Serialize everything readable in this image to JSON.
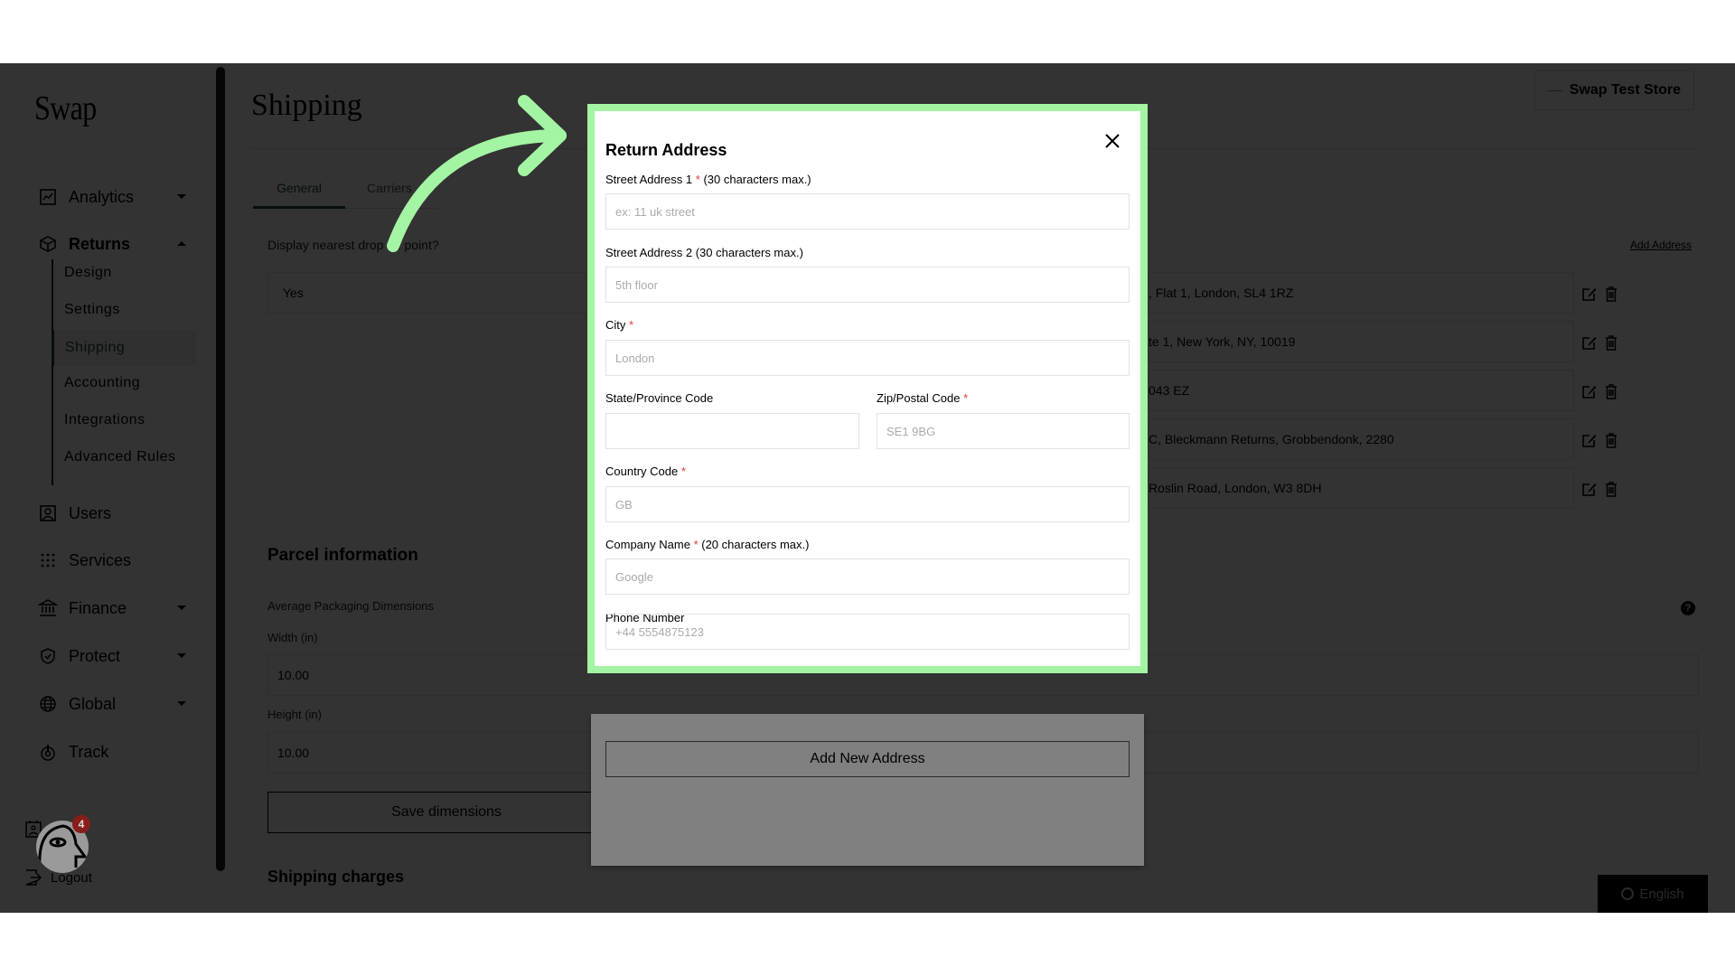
{
  "sidebar": {
    "logo": "Swap",
    "items": [
      {
        "label": "Analytics",
        "icon": "chart-icon",
        "caret": "down"
      },
      {
        "label": "Returns",
        "icon": "box-icon",
        "caret": "up"
      },
      {
        "label": "Users",
        "icon": "user-icon"
      },
      {
        "label": "Services",
        "icon": "grid-icon"
      },
      {
        "label": "Finance",
        "icon": "bank-icon",
        "caret": "down"
      },
      {
        "label": "Protect",
        "icon": "shield-icon",
        "caret": "down"
      },
      {
        "label": "Global",
        "icon": "globe-icon",
        "caret": "down"
      },
      {
        "label": "Track",
        "icon": "track-icon"
      }
    ],
    "returns_sub": [
      "Design",
      "Settings",
      "Shipping",
      "Accounting",
      "Integrations",
      "Advanced Rules"
    ],
    "active_sub": "Shipping",
    "logout_label": "Logout",
    "avatar_badge": "4"
  },
  "header": {
    "title": "Shipping",
    "store_button": "Swap Test Store"
  },
  "tabs": [
    "General",
    "Carriers"
  ],
  "general": {
    "drop_off_label": "Display nearest drop off point?",
    "drop_off_value": "Yes",
    "add_address_link": "Add Address",
    "addresses": [
      ", Flat 1, London, SL4 1RZ",
      "te 1, New York, NY, 10019",
      "043 EZ",
      "C, Bleckmann Returns, Grobbendonk, 2280",
      " Roslin Road, London, W3 8DH"
    ]
  },
  "parcel": {
    "heading": "Parcel information",
    "dims_label": "Average Packaging Dimensions",
    "width_label": "Width (in)",
    "width_value": "10.00",
    "height_label": "Height (in)",
    "height_value": "10.00",
    "save_button": "Save dimensions"
  },
  "shipping_charges_heading": "Shipping charges",
  "language_button": "English",
  "modal": {
    "title": "Return Address",
    "fields": {
      "street1": {
        "label": "Street Address 1",
        "required": true,
        "note": "(30 characters max.)",
        "placeholder": "ex: 11 uk street"
      },
      "street2": {
        "label": "Street Address 2 (30 characters max.)",
        "placeholder": "5th floor"
      },
      "city": {
        "label": "City",
        "required": true,
        "placeholder": "London"
      },
      "state": {
        "label": "State/Province Code",
        "placeholder": ""
      },
      "zip": {
        "label": "Zip/Postal Code",
        "required": true,
        "placeholder": "SE1 9BG"
      },
      "country": {
        "label": "Country Code",
        "required": true,
        "placeholder": "GB"
      },
      "company": {
        "label": "Company Name",
        "required": true,
        "note": "(20 characters max.)",
        "placeholder": "Google"
      },
      "phone": {
        "label": "Phone Number",
        "placeholder": "+44 5554875123"
      }
    },
    "required_mark": "*",
    "submit_button": "Add New Address"
  },
  "colors": {
    "highlight": "#a3f5a3",
    "accent": "#1e4a32",
    "required": "#e03c3c"
  }
}
